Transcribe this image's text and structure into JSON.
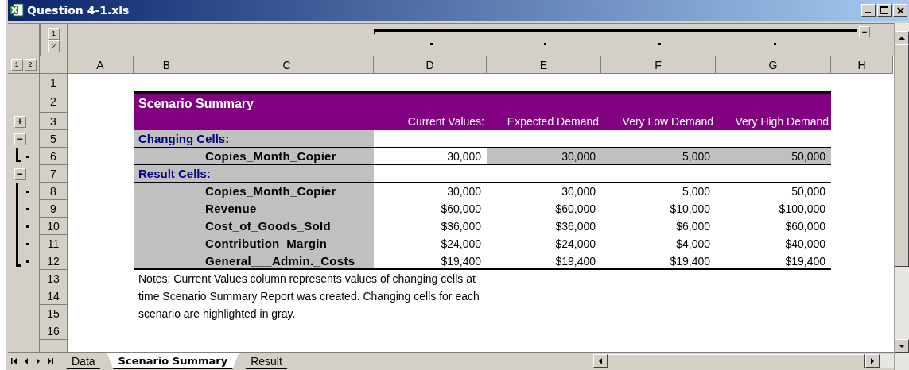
{
  "window": {
    "title": "Question 4-1.xls"
  },
  "outline": {
    "column_levels": [
      "1",
      "2"
    ],
    "row_levels": [
      "1",
      "2"
    ],
    "column_button": "−"
  },
  "columns": [
    "A",
    "B",
    "C",
    "D",
    "E",
    "F",
    "G",
    "H"
  ],
  "row_headers": [
    {
      "label": "1"
    },
    {
      "label": "2"
    },
    {
      "label": "3",
      "symbol": "+"
    },
    {
      "label": "5",
      "symbol": "−"
    },
    {
      "label": "6",
      "detail": true
    },
    {
      "label": "7",
      "symbol": "−"
    },
    {
      "label": "8",
      "detail": true
    },
    {
      "label": "9",
      "detail": true
    },
    {
      "label": "10",
      "detail": true
    },
    {
      "label": "11",
      "detail": true
    },
    {
      "label": "12",
      "detail": true
    },
    {
      "label": "13"
    },
    {
      "label": "14"
    },
    {
      "label": "15"
    },
    {
      "label": "16"
    }
  ],
  "summary": {
    "title": "Scenario Summary",
    "column_headings": [
      "Current Values:",
      "Expected Demand",
      "Very Low Demand",
      "Very High Demand"
    ],
    "sections": [
      {
        "heading": "Changing Cells:",
        "rows": [
          {
            "label": "Copies_Month_Copier",
            "values": [
              "30,000",
              "30,000",
              "5,000",
              "50,000"
            ],
            "highlighted": true
          }
        ]
      },
      {
        "heading": "Result Cells:",
        "rows": [
          {
            "label": "Copies_Month_Copier",
            "values": [
              "30,000",
              "30,000",
              "5,000",
              "50,000"
            ],
            "highlighted": false
          },
          {
            "label": "Revenue",
            "values": [
              "$60,000",
              "$60,000",
              "$10,000",
              "$100,000"
            ],
            "highlighted": false
          },
          {
            "label": "Cost_of_Goods_Sold",
            "values": [
              "$36,000",
              "$36,000",
              "$6,000",
              "$60,000"
            ],
            "highlighted": false
          },
          {
            "label": "Contribution_Margin",
            "values": [
              "$24,000",
              "$24,000",
              "$4,000",
              "$40,000"
            ],
            "highlighted": false
          },
          {
            "label": "General___Admin._Costs",
            "values": [
              "$19,400",
              "$19,400",
              "$19,400",
              "$19,400"
            ],
            "highlighted": false
          }
        ]
      }
    ]
  },
  "notes": [
    "Notes:  Current Values column represents values of changing cells at",
    "time Scenario Summary Report was created.  Changing cells for each",
    "scenario are highlighted in gray."
  ],
  "sheet_tabs": [
    {
      "label": "Data",
      "selected": false
    },
    {
      "label": "Scenario Summary",
      "selected": true
    },
    {
      "label": "Result",
      "selected": false
    }
  ]
}
